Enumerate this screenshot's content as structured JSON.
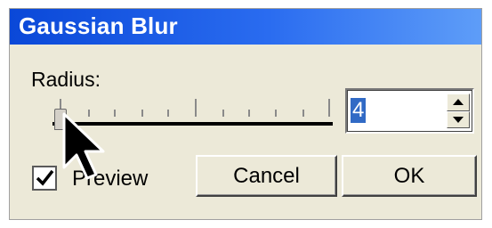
{
  "window": {
    "title": "Gaussian Blur"
  },
  "radius": {
    "label": "Radius:",
    "value": "4",
    "slider_fraction": 0.02
  },
  "preview": {
    "label": "Preview",
    "checked": true
  },
  "buttons": {
    "cancel_label": "Cancel",
    "ok_label": "OK"
  },
  "colors": {
    "titlebar_start": "#0a48d8",
    "titlebar_end": "#5e9df8",
    "selection": "#316ac5",
    "face": "#ece9d8"
  },
  "icons": {
    "cursor": "arrow-cursor-icon",
    "spin_up": "arrow-up-icon",
    "spin_down": "arrow-down-icon",
    "check": "checkmark-icon"
  }
}
